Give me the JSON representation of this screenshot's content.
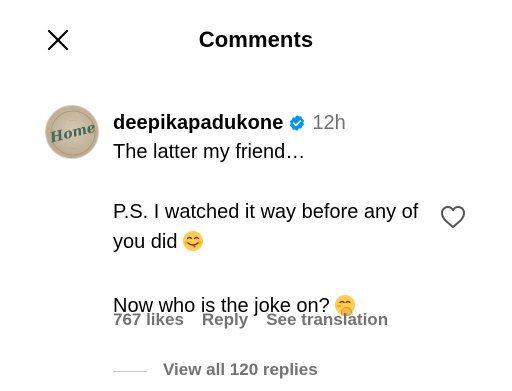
{
  "header": {
    "title": "Comments",
    "close_icon": "close-icon"
  },
  "comment": {
    "avatar_text": "Home",
    "username": "deepikapadukone",
    "verified_icon": "verified-badge-icon",
    "time": "12h",
    "paragraphs": [
      "The latter my friend…",
      "P.S. I watched it way before any of you did",
      "Now who is the joke on?"
    ],
    "emojis": [
      "smiling-face-with-tongue-emoji",
      "face-with-hand-over-mouth-emoji"
    ],
    "likes": "767 likes",
    "reply_label": "Reply",
    "translate_label": "See translation",
    "like_icon": "heart-outline-icon"
  },
  "replies": {
    "label": "View all 120 replies"
  },
  "colors": {
    "secondary_text": "#737373",
    "verified_blue": "#0095f6"
  }
}
